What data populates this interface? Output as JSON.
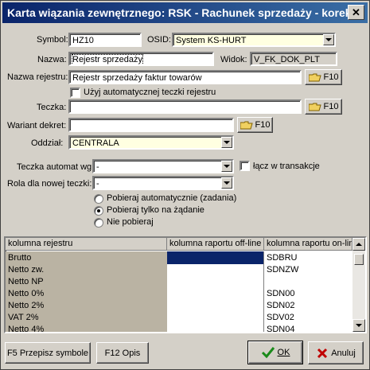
{
  "window": {
    "title": "Karta wiązania zewnętrznego: RSK - Rachunek sprzedaży - korekta",
    "close_glyph": "✕"
  },
  "form": {
    "symbol_label": "Symbol:",
    "symbol_value": "HZ10",
    "osid_label": "OSID:",
    "osid_value": "System KS-HURT",
    "nazwa_label": "Nazwa:",
    "nazwa_value": "Rejestr sprzedaży",
    "widok_label": "Widok:",
    "widok_value": "V_FK_DOK_PLT",
    "nazwa_rejestru_label": "Nazwa rejestru:",
    "nazwa_rejestru_value": "Rejestr sprzedaży faktur towarów",
    "auto_teczka_label": "Użyj automatycznej teczki rejestru",
    "teczka_label": "Teczka:",
    "teczka_value": "",
    "wariant_label": "Wariant dekret:",
    "wariant_value": "",
    "oddzial_label": "Oddział:",
    "oddzial_value": "CENTRALA",
    "teczka_automat_label": "Teczka automat wg:",
    "teczka_automat_value": "-",
    "lacz_label": "łącz w transakcje",
    "rola_label": "Rola dla nowej teczki:",
    "rola_value": "-",
    "radio_options": [
      "Pobieraj automatycznie (zadania)",
      "Pobieraj tylko na żądanie",
      "Nie pobieraj"
    ],
    "radio_selected": 1,
    "f10_label": "F10"
  },
  "grid": {
    "headers": [
      "kolumna rejestru",
      "kolumna raportu off-line",
      "kolumna raportu on-line"
    ],
    "rows": [
      {
        "c1": "Brutto",
        "c2": "",
        "c3": "SDBRU"
      },
      {
        "c1": "Netto zw.",
        "c2": "",
        "c3": "SDNZW"
      },
      {
        "c1": "Netto NP",
        "c2": "",
        "c3": ""
      },
      {
        "c1": "Netto 0%",
        "c2": "",
        "c3": "SDN00"
      },
      {
        "c1": "Netto 2%",
        "c2": "",
        "c3": "SDN02"
      },
      {
        "c1": "VAT   2%",
        "c2": "",
        "c3": "SDV02"
      },
      {
        "c1": "Netto 4%",
        "c2": "",
        "c3": "SDN04"
      }
    ]
  },
  "buttons": {
    "przepisz": "F5 Przepisz symbole",
    "opis": "F12 Opis",
    "ok": "OK",
    "anuluj": "Anuluj"
  },
  "colors": {
    "title_bar": "#0a246a",
    "field_yellow": "#ffffe1",
    "selected_cell": "#0a246a",
    "ok_check": "#1a8a1a",
    "cancel_x": "#c00000"
  }
}
